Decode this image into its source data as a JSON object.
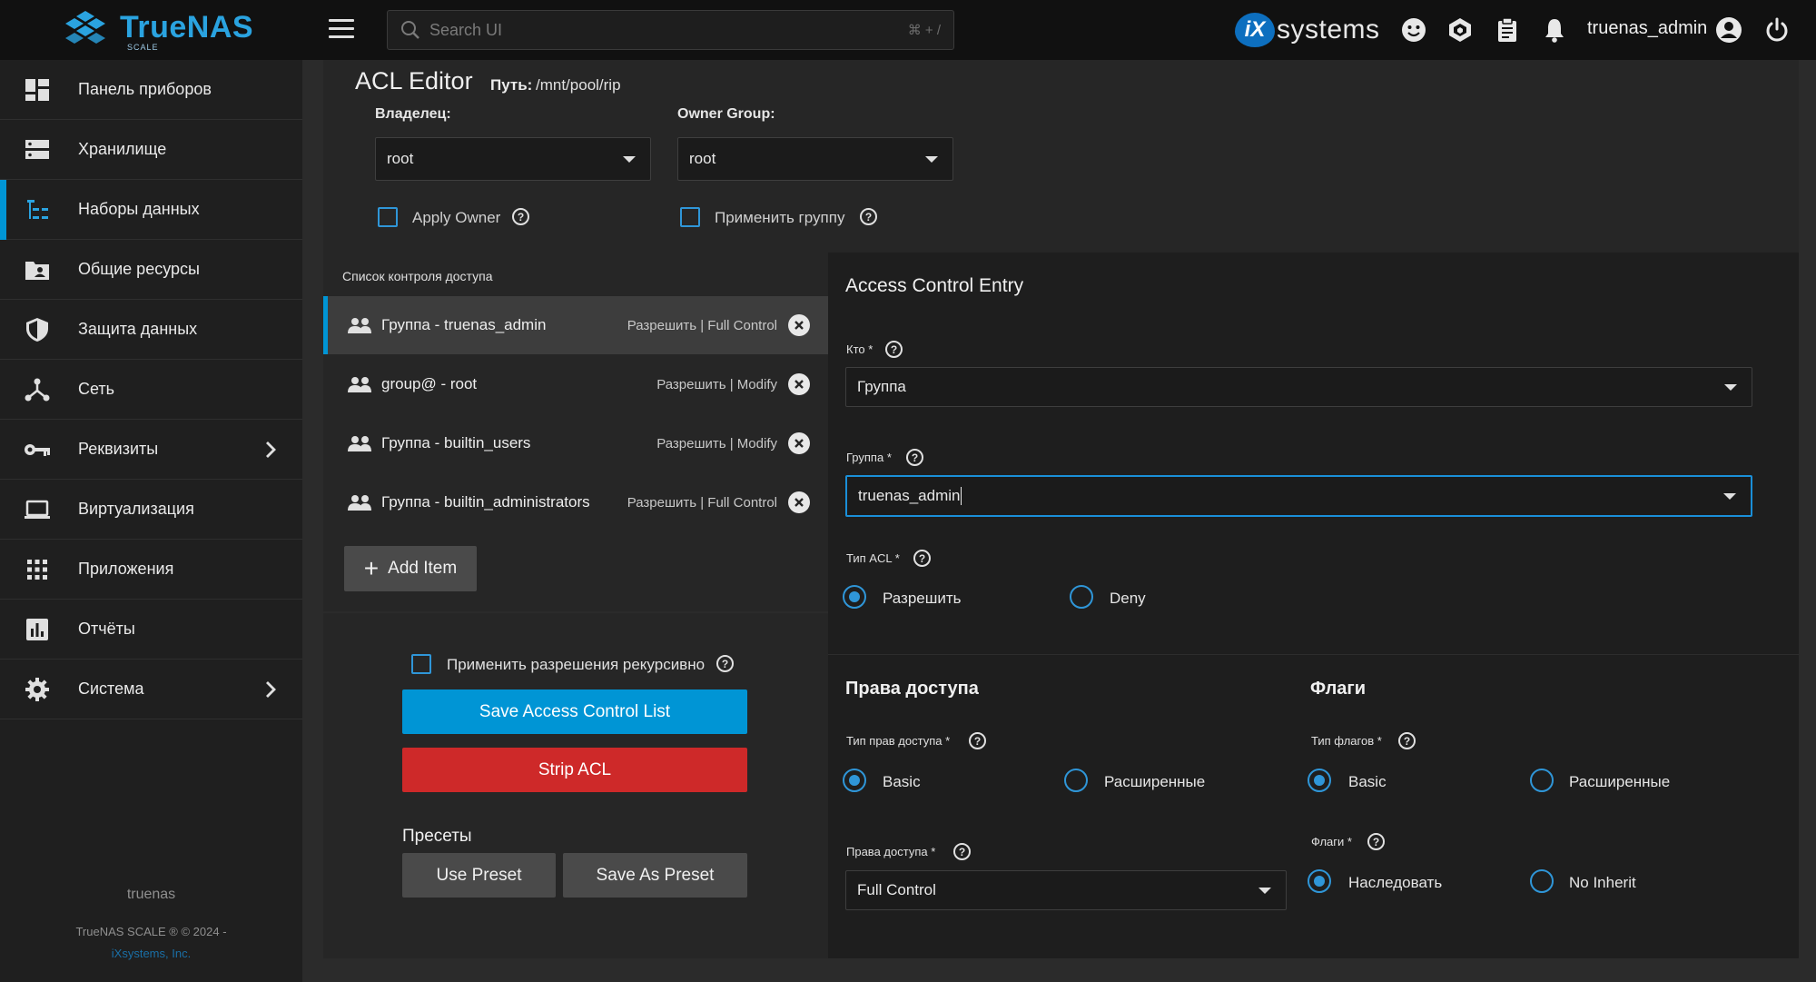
{
  "header": {
    "brand": "TrueNAS",
    "brand_sub": "SCALE",
    "search_placeholder": "Search UI",
    "search_shortcut": "⌘ + /",
    "vendor_ix": "iX",
    "vendor_name": "systems",
    "username": "truenas_admin"
  },
  "sidebar": {
    "items": [
      {
        "label": "Панель приборов",
        "icon": "dashboard-icon"
      },
      {
        "label": "Хранилище",
        "icon": "storage-icon"
      },
      {
        "label": "Наборы данных",
        "icon": "datasets-icon",
        "active": true
      },
      {
        "label": "Общие ресурсы",
        "icon": "shares-icon"
      },
      {
        "label": "Защита данных",
        "icon": "shield-icon"
      },
      {
        "label": "Сеть",
        "icon": "network-icon"
      },
      {
        "label": "Реквизиты",
        "icon": "key-icon",
        "chevron": true
      },
      {
        "label": "Виртуализация",
        "icon": "laptop-icon"
      },
      {
        "label": "Приложения",
        "icon": "apps-grid-icon"
      },
      {
        "label": "Отчёты",
        "icon": "reports-icon"
      },
      {
        "label": "Система",
        "icon": "gear-icon",
        "chevron": true
      }
    ],
    "footer_host": "truenas",
    "footer_copy": "TrueNAS SCALE ® © 2024 -",
    "footer_company": "iXsystems, Inc."
  },
  "editor": {
    "title": "ACL Editor",
    "path_label": "Путь:",
    "path_value": "/mnt/pool/rip",
    "owner_label": "Владелец:",
    "owner_value": "root",
    "owner_group_label": "Owner Group:",
    "owner_group_value": "root",
    "apply_owner_label": "Apply Owner",
    "apply_group_label": "Применить группу"
  },
  "acl_list": {
    "title": "Список контроля доступа",
    "entries": [
      {
        "name": "Группа - truenas_admin",
        "perm": "Разрешить | Full Control",
        "active": true
      },
      {
        "name": "group@ - root",
        "perm": "Разрешить | Modify"
      },
      {
        "name": "Группа - builtin_users",
        "perm": "Разрешить | Modify"
      },
      {
        "name": "Группа - builtin_administrators",
        "perm": "Разрешить | Full Control"
      }
    ],
    "add_item_label": "Add Item"
  },
  "actions": {
    "recursive_label": "Применить разрешения рекурсивно",
    "save_label": "Save Access Control List",
    "strip_label": "Strip ACL",
    "presets_label": "Пресеты",
    "use_preset_label": "Use Preset",
    "save_preset_label": "Save As Preset"
  },
  "ace": {
    "title": "Access Control Entry",
    "who_label": "Кто *",
    "who_value": "Группа",
    "group_label": "Группа *",
    "group_value": "truenas_admin",
    "acl_type_label": "Тип ACL *",
    "acl_type_allow": "Разрешить",
    "acl_type_deny": "Deny",
    "perms_title": "Права доступа",
    "perms_type_label": "Тип прав доступа *",
    "perms_basic": "Basic",
    "perms_advanced": "Расширенные",
    "perms_label": "Права доступа *",
    "perms_value": "Full Control",
    "flags_title": "Флаги",
    "flags_type_label": "Тип флагов *",
    "flags_basic": "Basic",
    "flags_advanced": "Расширенные",
    "flags_label": "Флаги *",
    "flags_inherit": "Наследовать",
    "flags_no_inherit": "No Inherit"
  }
}
